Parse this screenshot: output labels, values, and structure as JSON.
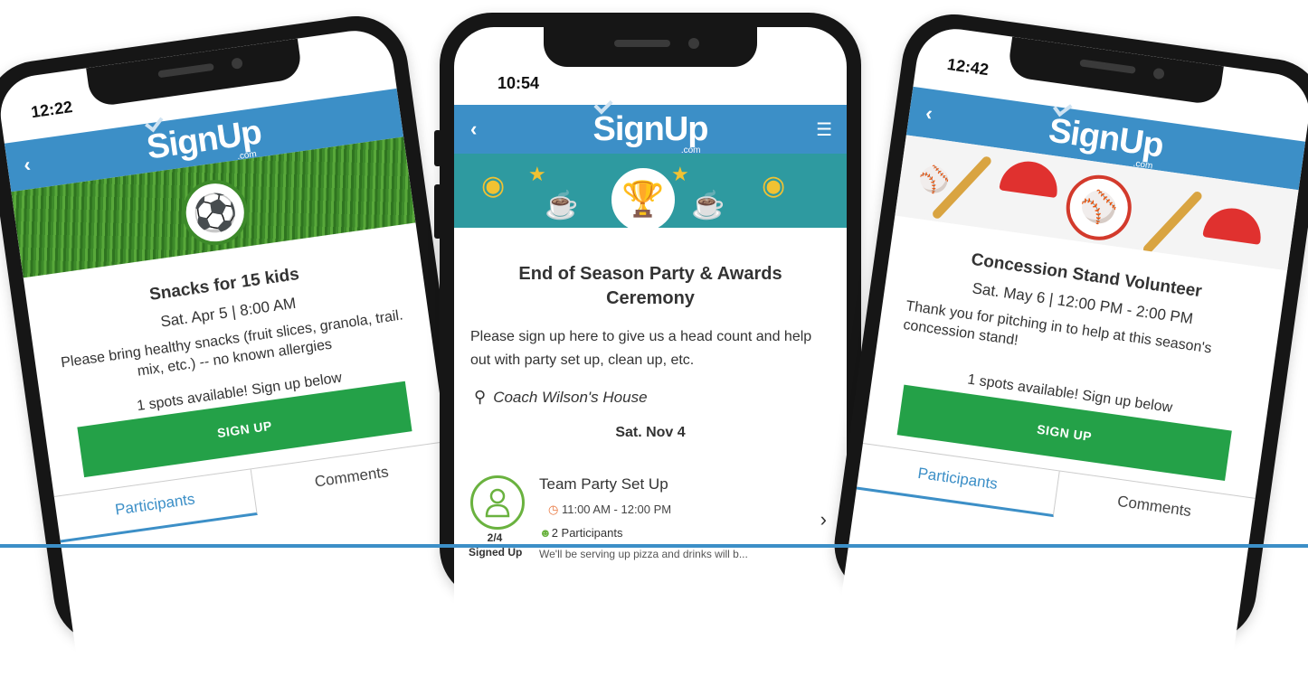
{
  "brand": {
    "name": "SignUp",
    "suffix": ".com",
    "accent": "#3c8fc7",
    "button_color": "#24a148"
  },
  "phones": [
    {
      "time": "12:22",
      "banner_icon": "soccer-ball-icon",
      "title": "Snacks for 15 kids",
      "date": "Sat. Apr 5 | 8:00 AM",
      "description": "Please bring healthy snacks (fruit slices, granola, trail. mix, etc.) -- no known allergies",
      "spots": "1 spots available! Sign up below",
      "signup_label": "SIGN UP",
      "tabs": [
        "Participants",
        "Comments"
      ]
    },
    {
      "time": "10:54",
      "banner_icon": "trophy-icon",
      "title": "End of Season Party & Awards Ceremony",
      "description": "Please sign up here to give us a head count and help out with party set up, clean up, etc.",
      "location": "Coach Wilson's House",
      "date_heading": "Sat. Nov 4",
      "slot": {
        "title": "Team Party Set Up",
        "time": "11:00 AM - 12:00 PM",
        "participants": "2 Participants",
        "note": "We'll be serving up pizza and drinks will b...",
        "fraction": "2/4",
        "signed_label": "Signed Up"
      }
    },
    {
      "time": "12:42",
      "banner_icon": "baseball-icon",
      "title": "Concession Stand Volunteer",
      "date": "Sat. May 6 | 12:00 PM - 2:00 PM",
      "description": "Thank you for pitching in to help at this season's concession stand!",
      "spots": "1 spots available! Sign up below",
      "signup_label": "SIGN UP",
      "tabs": [
        "Participants",
        "Comments"
      ]
    }
  ]
}
